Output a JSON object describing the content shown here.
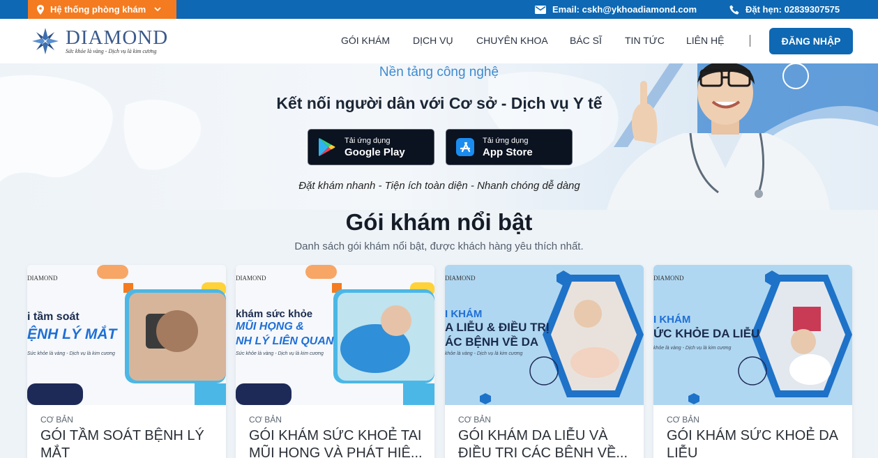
{
  "topbar": {
    "clinic_select": "Hệ thống phòng khám",
    "email": "Email: cskh@ykhoadiamond.com",
    "phone": "Đặt hẹn: 02839307575"
  },
  "header": {
    "logo_name": "DIAMOND",
    "logo_slogan": "Sức khỏe là vàng - Dịch vụ là kim cương",
    "nav": [
      "GÓI KHÁM",
      "DỊCH VỤ",
      "CHUYÊN KHOA",
      "BÁC SĨ",
      "TIN TỨC",
      "LIÊN HỆ"
    ],
    "login": "ĐĂNG NHẬP"
  },
  "hero": {
    "subtitle": "Nền tảng công nghệ",
    "title": "Kết nối người dân với  Cơ sở - Dịch vụ Y tế",
    "google_play": {
      "small": "Tải ứng dụng",
      "big": "Google Play"
    },
    "app_store": {
      "small": "Tải ứng dụng",
      "big": "App Store"
    },
    "tagline": "Đặt khám nhanh - Tiện ích toàn diện - Nhanh chóng dễ dàng"
  },
  "section": {
    "title": "Gói khám nổi bật",
    "subtitle": "Danh sách gói khám nổi bật, được khách hàng yêu thích nhất."
  },
  "cards": [
    {
      "category": "CƠ BẢN",
      "title": "GÓI TẦM SOÁT BỆNH LÝ MẮT",
      "img_brand": "DIAMOND",
      "img_line1": "i tầm soát",
      "img_line2": "ỆNH LÝ MẮT",
      "img_line3": "",
      "img_slogan": "Sức khỏe là vàng - Dịch vụ là kim cương"
    },
    {
      "category": "CƠ BẢN",
      "title": "GÓI KHÁM SỨC KHOẺ TAI MŨI HỌNG VÀ PHÁT HIỆ...",
      "img_brand": "DIAMOND",
      "img_line1": "khám sức khỏe",
      "img_line2": "MŨI HỌNG &",
      "img_line3": "NH LÝ LIÊN QUAN",
      "img_slogan": "Sức khỏe là vàng - Dịch vụ là kim cương"
    },
    {
      "category": "CƠ BẢN",
      "title": "GÓI KHÁM DA LIỄU VÀ ĐIỀU TRỊ CÁC BỆNH VỀ...",
      "img_brand": "DIAMOND",
      "img_line1": "I KHÁM",
      "img_line2": "A LIỄU & ĐIỀU TRỊ",
      "img_line3": "ÁC BỆNH VỀ DA",
      "img_slogan": "khỏe là vàng - Dịch vụ là kim cương"
    },
    {
      "category": "CƠ BẢN",
      "title": "GÓI KHÁM SỨC KHOẺ DA LIỄU",
      "img_brand": "DIAMOND",
      "img_line1": "I KHÁM",
      "img_line2": "ỨC KHỎE DA LIỄU",
      "img_line3": "",
      "img_slogan": "khỏe là vàng - Dịch vụ là kim cương"
    }
  ],
  "colors": {
    "primary": "#0e68b3",
    "accent_orange": "#f47b20",
    "hero_subtitle": "#3e8bd0"
  }
}
